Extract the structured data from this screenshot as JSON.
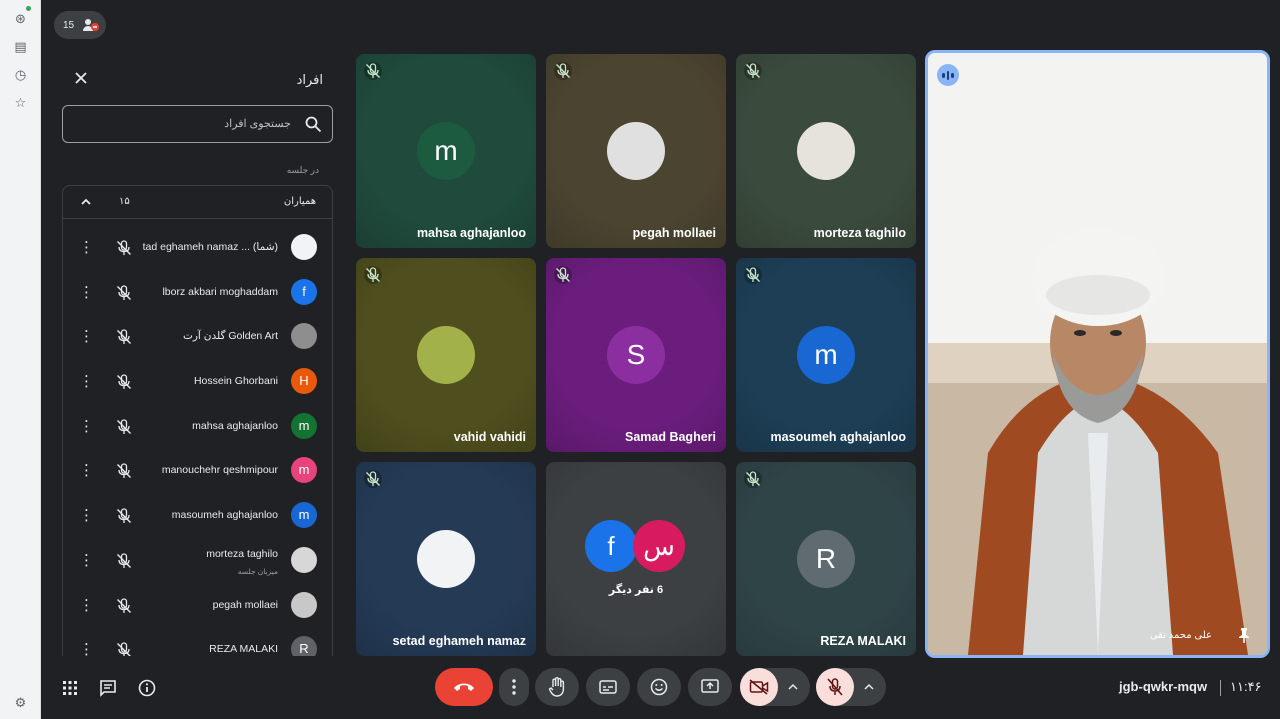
{
  "participant_count": "15",
  "panel": {
    "title": "افراد",
    "search_placeholder": "جستجوی افراد",
    "section_label": "در جلسه",
    "group_name": "همیاران",
    "group_count": "۱۵",
    "people": [
      {
        "name": "tad eghameh namaz ... (شما)",
        "avatar": "",
        "color": "#f1f3f4"
      },
      {
        "name": "lborz akbari moghaddam",
        "avatar": "f",
        "color": "#1a73e8"
      },
      {
        "name": "گلدن آرت Golden Art",
        "avatar": "",
        "color": "#8e8e8e"
      },
      {
        "name": "Hossein Ghorbani",
        "avatar": "H",
        "color": "#e8590c"
      },
      {
        "name": "mahsa aghajanloo",
        "avatar": "m",
        "color": "#137333"
      },
      {
        "name": "manouchehr qeshmipour",
        "avatar": "m",
        "color": "#e8437b"
      },
      {
        "name": "masoumeh aghajanloo",
        "avatar": "m",
        "color": "#1967d2"
      },
      {
        "name": "morteza taghilo",
        "role": "میزبان جلسه",
        "avatar": "",
        "color": "#d7d7d7"
      },
      {
        "name": "pegah mollaei",
        "avatar": "",
        "color": "#c8c8c8"
      },
      {
        "name": "REZA MALAKI",
        "avatar": "R",
        "color": "#5f6368"
      }
    ]
  },
  "tiles": [
    {
      "name": "mahsa aghajanloo",
      "avatar": "m",
      "bg": "#1f4a3c",
      "av_bg": "#1c5b40"
    },
    {
      "name": "pegah mollaei",
      "avatar": "",
      "bg": "#4a4430",
      "av_bg": "#e0e0e0"
    },
    {
      "name": "morteza taghilo",
      "avatar": "",
      "bg": "#3a4a3c",
      "av_bg": "#e6e2dc"
    },
    {
      "name": "vahid vahidi",
      "avatar": "",
      "bg": "#4e4e1e",
      "av_bg": "#a3b14a"
    },
    {
      "name": "Samad Bagheri",
      "avatar": "S",
      "bg": "#6a1d7c",
      "av_bg": "#8b2ea0"
    },
    {
      "name": "masoumeh aghajanloo",
      "avatar": "m",
      "bg": "#1d3e55",
      "av_bg": "#1967d2"
    },
    {
      "name": "setad eghameh namaz",
      "avatar": "",
      "bg": "#243a55",
      "av_bg": "#f1f3f4"
    },
    {
      "name": "",
      "avatar": "",
      "bg": "#3c4043",
      "av_bg": ""
    },
    {
      "name": "REZA MALAKI",
      "avatar": "R",
      "bg": "#2f4447",
      "av_bg": "#5f6b70"
    }
  ],
  "others": {
    "label": "6 نفر دیگر",
    "avatar1": "f",
    "avatar2": "س"
  },
  "main_video": {
    "name": "علی محمد تقی"
  },
  "meeting_code": "jgb-qwkr-mqw",
  "clock": "۱۱:۴۶",
  "colors": {
    "accent": "#8ab4f8",
    "end_call": "#ea4335",
    "muted": "#f9dedc"
  }
}
